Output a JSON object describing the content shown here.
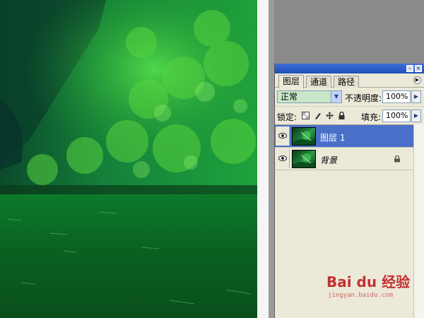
{
  "palette": {
    "tabs": [
      "图层",
      "通道",
      "路径"
    ],
    "active_tab_index": 0,
    "blend_mode": "正常",
    "opacity_label": "不透明度:",
    "opacity_value": "100%",
    "lock_label": "锁定:",
    "fill_label": "填充:",
    "fill_value": "100%",
    "layers": [
      {
        "name": "图层 1",
        "selected": true,
        "visible": true,
        "locked": false
      },
      {
        "name": "背景",
        "selected": false,
        "visible": true,
        "locked": true
      }
    ]
  },
  "icons": {
    "lock_icons": [
      "lock-transparent-icon",
      "lock-brush-icon",
      "lock-move-icon",
      "lock-all-icon"
    ],
    "eye": "eye-icon",
    "palette_menu": "palette-menu-icon"
  },
  "watermark": {
    "text": "Bai du 经验",
    "sub": "jingyan.baidu.com"
  },
  "colors": {
    "titlebar": "#2a5bc9",
    "selected_row": "#4a70c9",
    "blend_field": "#c8e6c8",
    "panel_bg": "#ece9d8"
  }
}
